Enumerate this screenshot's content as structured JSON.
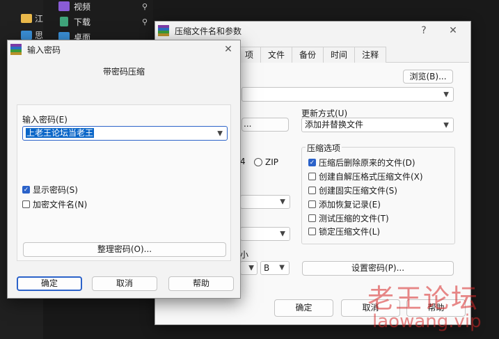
{
  "explorer": {
    "nav_items": [
      {
        "label": "视频",
        "icon": "video-folder-icon",
        "color": "#8a5cd6"
      },
      {
        "label": "下载",
        "icon": "download-folder-icon",
        "color": "#3fa37a"
      },
      {
        "label": "桌面",
        "icon": "desktop-folder-icon",
        "color": "#3a8fd6"
      }
    ],
    "pin_glyph": "⚲",
    "folder_partial": "江",
    "side_partial": "思"
  },
  "main_dialog": {
    "title": "压缩文件名和参数",
    "help_glyph": "?",
    "close_glyph": "✕",
    "tabs": [
      "项",
      "文件",
      "备份",
      "时间",
      "注释"
    ],
    "browse_label": "浏览(B)...",
    "archive_name_value": "",
    "update_mode_label": "更新方式(U)",
    "update_mode_value": "添加并替换文件",
    "profile_button_partial": "...",
    "format_rar4_partial": "4",
    "format_zip": "ZIP",
    "options_title": "压缩选项",
    "options": [
      {
        "label": "压缩后删除原来的文件(D)",
        "checked": true
      },
      {
        "label": "创建自解压格式压缩文件(X)",
        "checked": false
      },
      {
        "label": "创建固实压缩文件(S)",
        "checked": false
      },
      {
        "label": "添加恢复记录(E)",
        "checked": false
      },
      {
        "label": "测试压缩的文件(T)",
        "checked": false
      },
      {
        "label": "锁定压缩文件(L)",
        "checked": false
      }
    ],
    "volume_size_partial": "小",
    "volume_unit": "B",
    "set_password_label": "设置密码(P)...",
    "ok_label": "确定",
    "cancel_label": "取消",
    "help_label": "帮助"
  },
  "password_dialog": {
    "title": "输入密码",
    "close_glyph": "✕",
    "heading": "带密码压缩",
    "password_label": "输入密码(E)",
    "password_value": "上老王论坛当老王",
    "show_password_label": "显示密码(S)",
    "show_password_checked": true,
    "encrypt_names_label": "加密文件名(N)",
    "encrypt_names_checked": false,
    "organize_label": "整理密码(O)...",
    "ok_label": "确定",
    "cancel_label": "取消",
    "help_label": "帮助"
  },
  "watermark": {
    "text": "老王论坛",
    "url": "laowang.vip",
    "color": "#d72828"
  }
}
